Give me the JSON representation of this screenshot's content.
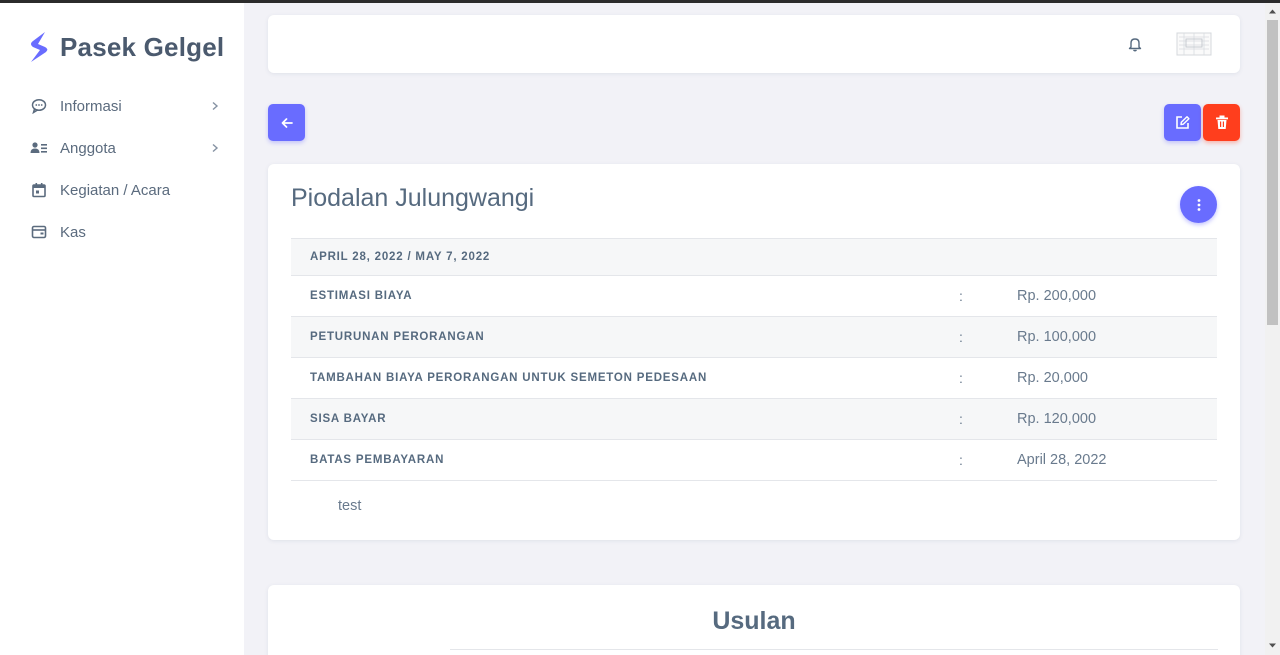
{
  "brand": {
    "name": "Pasek Gelgel",
    "logo_icon": "s-bolt-icon",
    "logo_color": "#696cff"
  },
  "sidebar": {
    "items": [
      {
        "label": "Informasi",
        "icon": "chat-bubble-icon",
        "has_submenu": true
      },
      {
        "label": "Anggota",
        "icon": "user-list-icon",
        "has_submenu": true
      },
      {
        "label": "Kegiatan / Acara",
        "icon": "calendar-icon",
        "has_submenu": false
      },
      {
        "label": "Kas",
        "icon": "wallet-icon",
        "has_submenu": false
      }
    ]
  },
  "navbar": {
    "notification_icon": "bell-icon",
    "avatar_icon": "user-avatar-icon"
  },
  "actions": {
    "back_icon": "arrow-left-icon",
    "edit_icon": "edit-icon",
    "delete_icon": "trash-icon",
    "primary_color": "#696cff",
    "danger_color": "#ff3e1d"
  },
  "event": {
    "title": "Piodalan Julungwangi",
    "date_range": "APRIL 28, 2022 / MAY 7, 2022",
    "rows": [
      {
        "label": "ESTIMASI BIAYA",
        "sep": ":",
        "value": "Rp. 200,000"
      },
      {
        "label": "PETURUNAN PERORANGAN",
        "sep": ":",
        "value": "Rp. 100,000"
      },
      {
        "label": "TAMBAHAN BIAYA PERORANGAN UNTUK SEMETON PEDESAAN",
        "sep": ":",
        "value": "Rp. 20,000"
      },
      {
        "label": "SISA BAYAR",
        "sep": ":",
        "value": "Rp. 120,000"
      },
      {
        "label": "BATAS PEMBAYARAN",
        "sep": ":",
        "value": "April 28, 2022"
      }
    ],
    "note": "test"
  },
  "usulan": {
    "title": "Usulan"
  }
}
